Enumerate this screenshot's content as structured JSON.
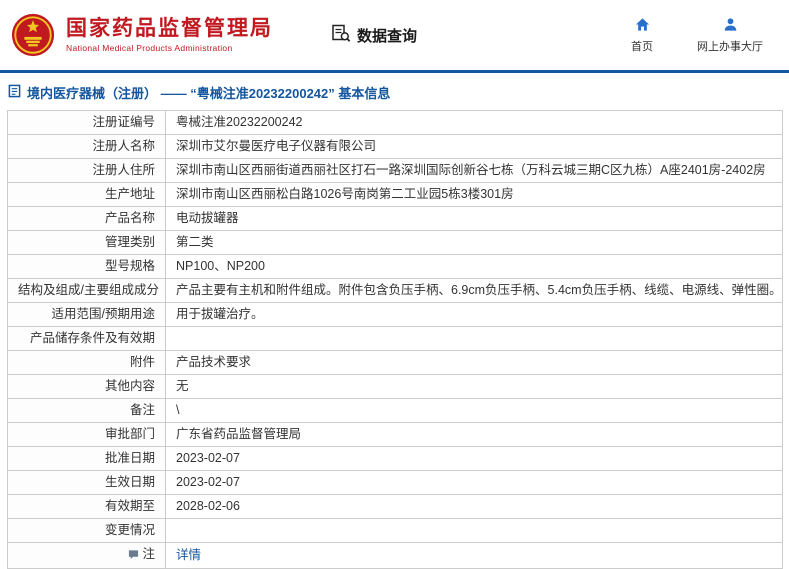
{
  "header": {
    "agency_name": "国家药品监督管理局",
    "agency_name_en": "National Medical Products Administration",
    "nav_data_query": "数据查询",
    "home_label": "首页",
    "hall_label": "网上办事大厅"
  },
  "icons": {
    "emblem": "national-emblem-icon",
    "data_query": "clipboard-search-icon",
    "home": "home-icon",
    "hall": "user-icon",
    "breadcrumb": "document-icon",
    "note_row": "note-icon"
  },
  "colors": {
    "brand_red": "#c01920",
    "brand_gold": "#f3c622",
    "link_blue": "#1456a0",
    "icon_blue": "#2a6fc9",
    "table_border": "#cccccc"
  },
  "breadcrumb": {
    "text": "境内医疗器械（注册） —— “粤械注准20232200242” 基本信息"
  },
  "table": {
    "rows": [
      {
        "label": "注册证编号",
        "value": "粤械注准20232200242"
      },
      {
        "label": "注册人名称",
        "value": "深圳市艾尔曼医疗电子仪器有限公司"
      },
      {
        "label": "注册人住所",
        "value": "深圳市南山区西丽街道西丽社区打石一路深圳国际创新谷七栋（万科云城三期C区九栋）A座2401房-2402房"
      },
      {
        "label": "生产地址",
        "value": "深圳市南山区西丽松白路1026号南岗第二工业园5栋3楼301房"
      },
      {
        "label": "产品名称",
        "value": "电动拔罐器"
      },
      {
        "label": "管理类别",
        "value": "第二类"
      },
      {
        "label": "型号规格",
        "value": "NP100、NP200"
      },
      {
        "label": "结构及组成/主要组成成分",
        "value": "产品主要有主机和附件组成。附件包含负压手柄、6.9cm负压手柄、5.4cm负压手柄、线缆、电源线、弹性圈。"
      },
      {
        "label": "适用范围/预期用途",
        "value": "用于拔罐治疗。"
      },
      {
        "label": "产品储存条件及有效期",
        "value": ""
      },
      {
        "label": "附件",
        "value": "产品技术要求"
      },
      {
        "label": "其他内容",
        "value": "无"
      },
      {
        "label": "备注",
        "value": "\\"
      },
      {
        "label": "审批部门",
        "value": "广东省药品监督管理局"
      },
      {
        "label": "批准日期",
        "value": "2023-02-07"
      },
      {
        "label": "生效日期",
        "value": "2023-02-07"
      },
      {
        "label": "有效期至",
        "value": "2028-02-06"
      },
      {
        "label": "变更情况",
        "value": ""
      },
      {
        "label": "注",
        "value": "详情",
        "link": true,
        "icon": "note"
      }
    ]
  }
}
